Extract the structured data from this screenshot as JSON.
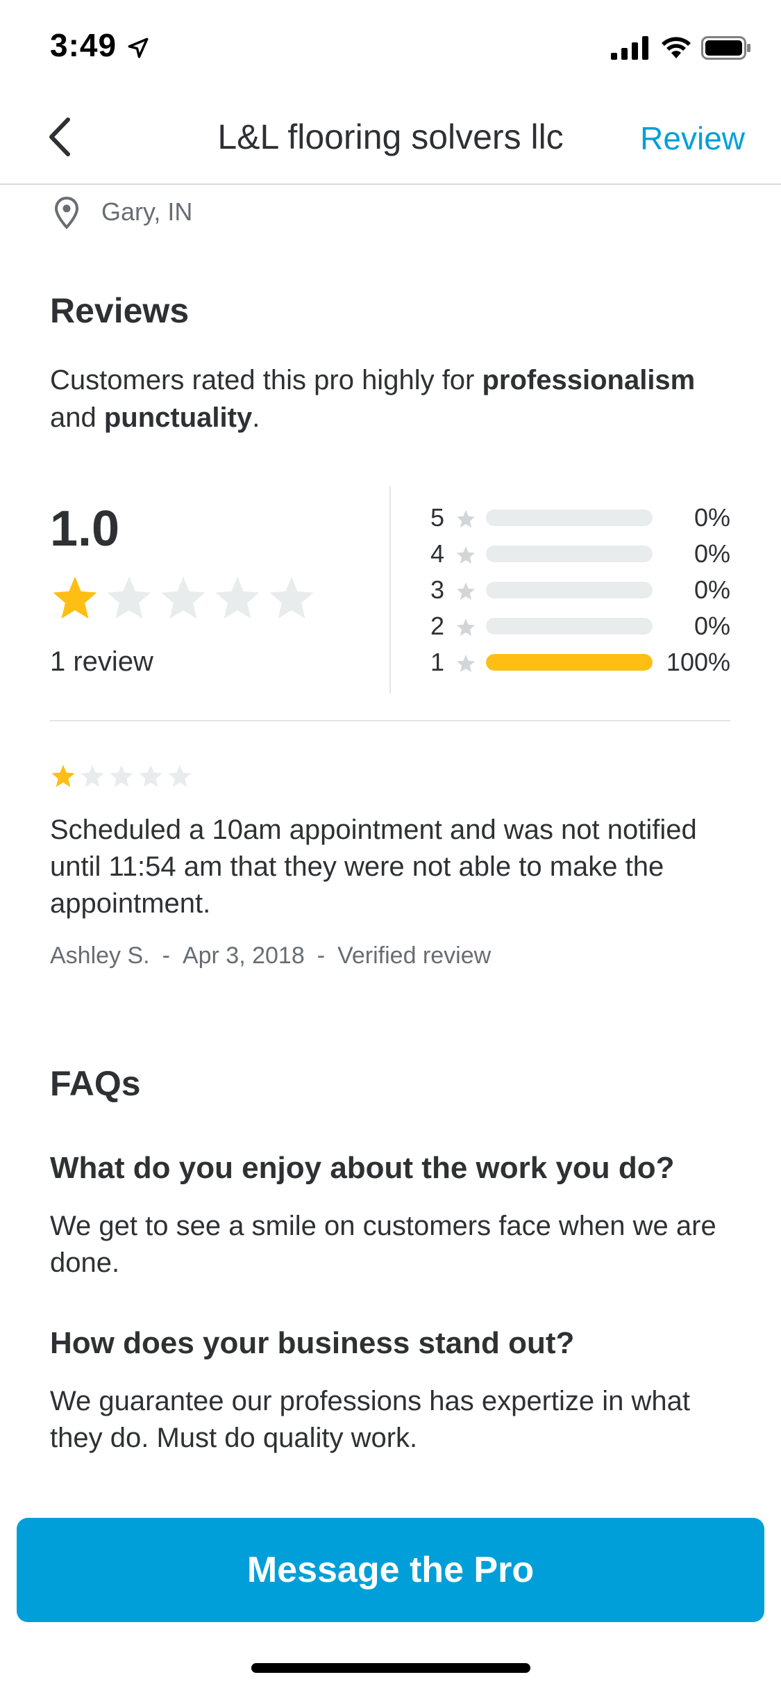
{
  "status_bar": {
    "time": "3:49"
  },
  "nav": {
    "title": "L&L flooring solvers llc",
    "action_label": "Review"
  },
  "location": {
    "text": "Gary, IN"
  },
  "reviews": {
    "heading": "Reviews",
    "summary_prefix": "Customers rated this pro highly for ",
    "summary_bold_1": "professionalism",
    "summary_mid": " and ",
    "summary_bold_2": "punctuality",
    "summary_suffix": ".",
    "rating": "1.0",
    "rating_value": 1,
    "rating_max": 5,
    "review_count": "1 review",
    "histogram": [
      {
        "stars": "5",
        "percent_label": "0%",
        "fraction": 0
      },
      {
        "stars": "4",
        "percent_label": "0%",
        "fraction": 0
      },
      {
        "stars": "3",
        "percent_label": "0%",
        "fraction": 0
      },
      {
        "stars": "2",
        "percent_label": "0%",
        "fraction": 0
      },
      {
        "stars": "1",
        "percent_label": "100%",
        "fraction": 1
      }
    ],
    "items": [
      {
        "stars": 1,
        "text": "Scheduled a 10am appointment and was not notified until 11:54 am that they were not able to make the appointment.",
        "author": "Ashley S.",
        "date": "Apr 3, 2018",
        "badge": "Verified review"
      }
    ]
  },
  "faqs": {
    "heading": "FAQs",
    "items": [
      {
        "question": "What do you enjoy about the work you do?",
        "answer": "We get to see a smile on customers face when we are done."
      },
      {
        "question": "How does your business stand out?",
        "answer": "We guarantee our professions has expertize  in what they do.  Must do quality work."
      }
    ]
  },
  "cta": {
    "label": "Message the Pro"
  },
  "colors": {
    "accent": "#009fd9",
    "star_filled": "#febe14",
    "star_empty": "#e9eced",
    "text": "#2f3033",
    "muted": "#676d73"
  },
  "icons": {
    "back": "chevron-left-icon",
    "location": "map-pin-icon",
    "star": "star-icon"
  }
}
